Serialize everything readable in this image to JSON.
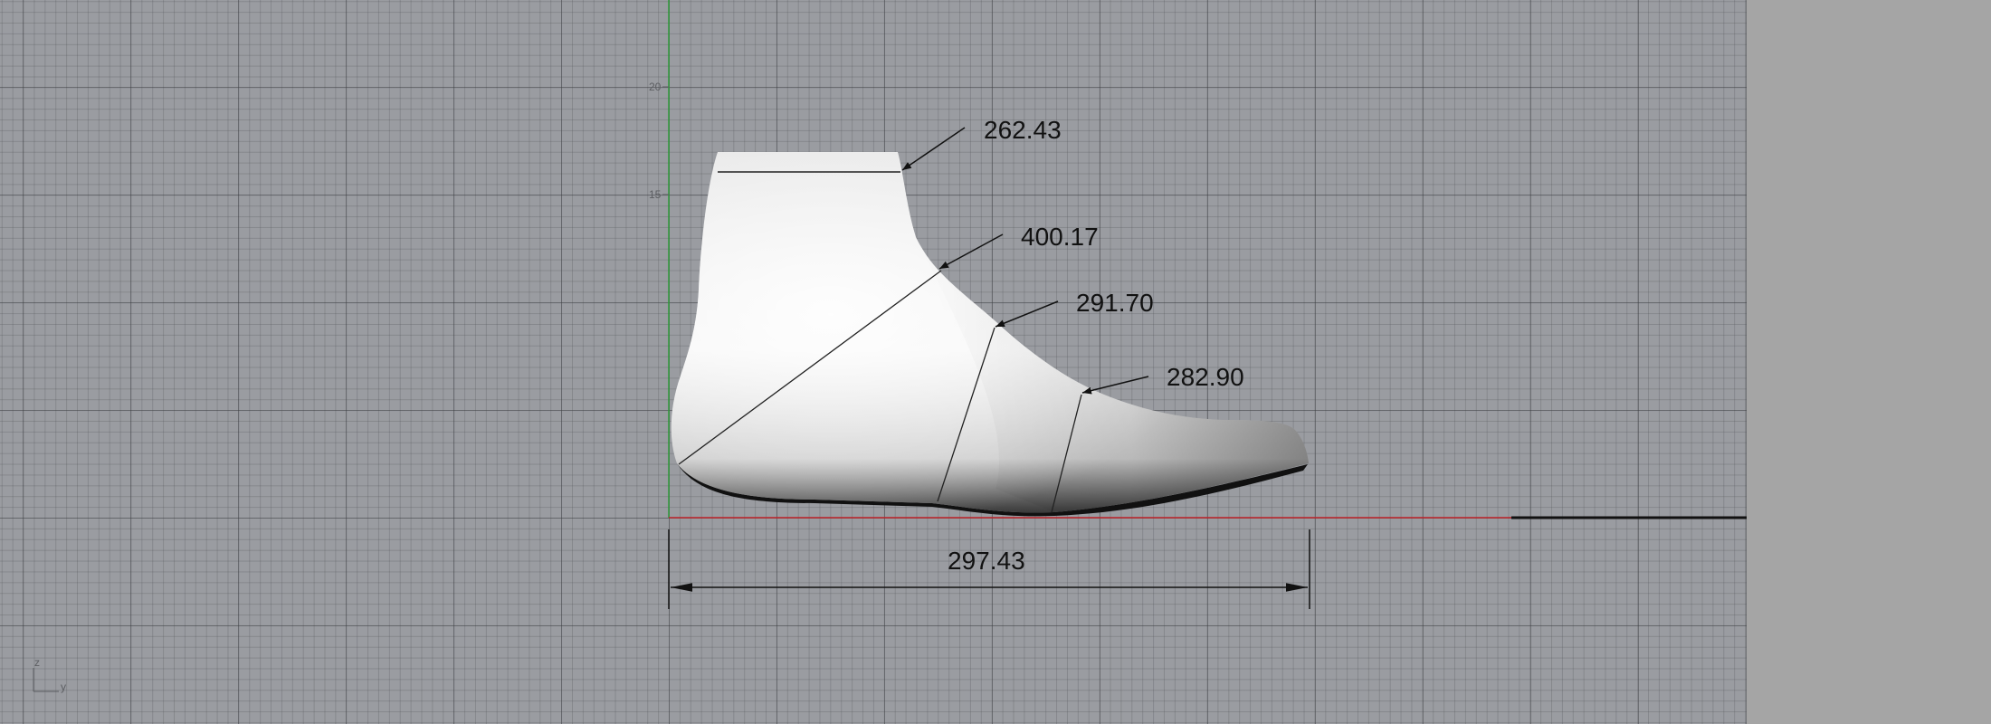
{
  "viewport": {
    "name": "right",
    "x_axis_color": "#c0232a",
    "y_axis_color": "#2f9a3a",
    "grid_ticks": [
      "20",
      "15"
    ]
  },
  "axis_indicator": {
    "vertical": "z",
    "horizontal": "y"
  },
  "dimensions": {
    "ankle": "262.43",
    "heel_instep": "400.17",
    "instep": "291.70",
    "ball": "282.90",
    "length": "297.43"
  },
  "model": {
    "type": "shoe-last",
    "fill": "#e8e8e8"
  }
}
